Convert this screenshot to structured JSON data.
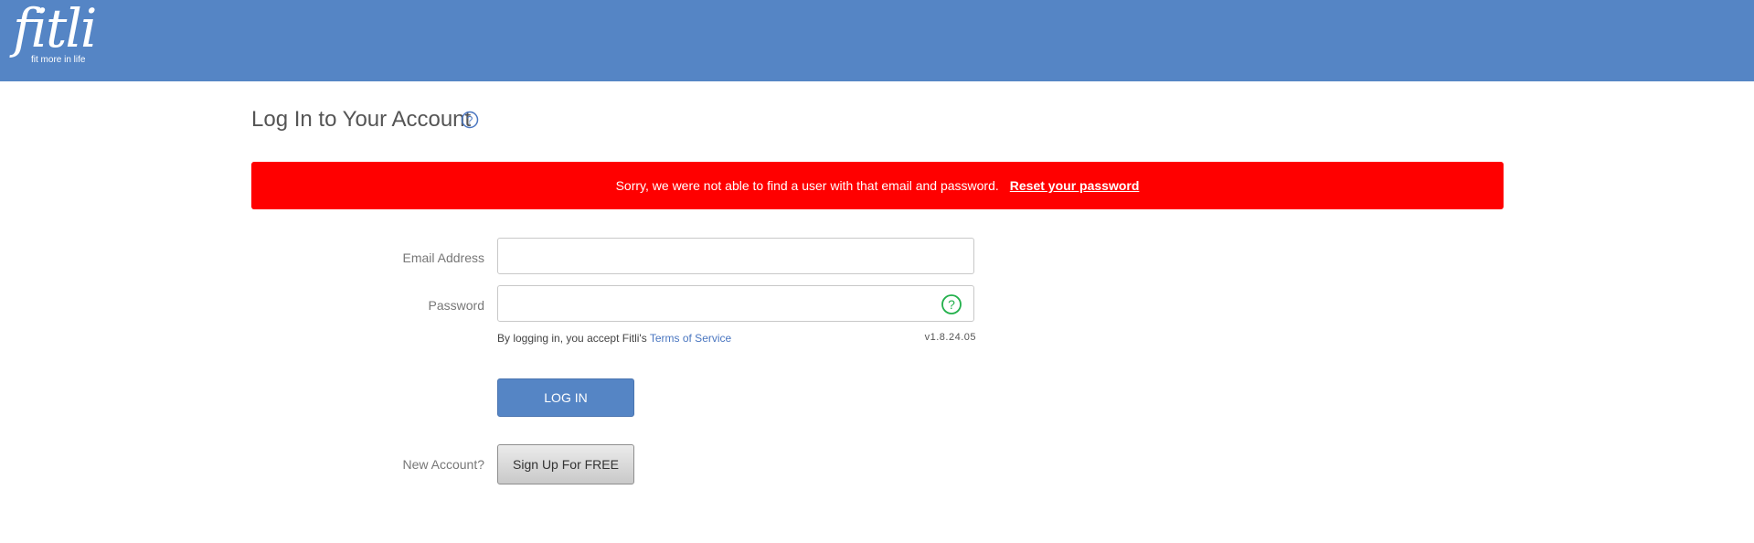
{
  "header": {
    "logo_text": "fitli",
    "logo_tagline": "fit more in life",
    "bg_color": "#5585c5"
  },
  "page": {
    "title": "Log In to Your Account",
    "help_icon": "question-circle-icon"
  },
  "error": {
    "message": "Sorry, we were not able to find a user with that email and password.",
    "reset_link": "Reset your password",
    "bg_color": "#ff0000"
  },
  "form": {
    "email_label": "Email Address",
    "email_value": "",
    "password_label": "Password",
    "password_value": "",
    "password_help_icon": "question-circle-icon",
    "tos_prefix": "By logging in, you accept Fitli's",
    "tos_link": "Terms of Service",
    "version": "v1.8.24.05",
    "login_button": "LOG IN",
    "new_account_label": "New Account?",
    "signup_button": "Sign Up For FREE"
  },
  "colors": {
    "accent": "#5585c5",
    "link": "#4a76c0",
    "help_icon_green": "#22b04b"
  }
}
